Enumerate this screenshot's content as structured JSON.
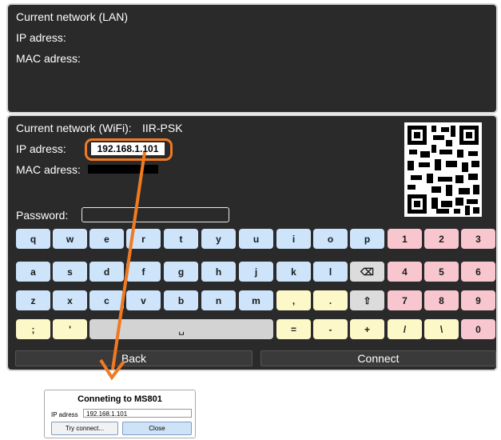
{
  "lan": {
    "title": "Current network (LAN)",
    "ip_label": "IP adress:",
    "mac_label": "MAC adress:"
  },
  "wifi": {
    "title_label": "Current network (WiFi):",
    "ssid": "IIR-PSK",
    "ip_label": "IP adress:",
    "ip_value": "192.168.1.101",
    "mac_label": "MAC adress:",
    "password_label": "Password:",
    "password_value": ""
  },
  "keyboard": {
    "rows": [
      [
        "q",
        "w",
        "e",
        "r",
        "t",
        "y",
        "u",
        "i",
        "o",
        "p",
        "1",
        "2",
        "3"
      ],
      [
        "a",
        "s",
        "d",
        "f",
        "g",
        "h",
        "j",
        "k",
        "l",
        "⌫",
        "4",
        "5",
        "6"
      ],
      [
        "z",
        "x",
        "c",
        "v",
        "b",
        "n",
        "m",
        ",",
        ".",
        "⇧",
        "7",
        "8",
        "9"
      ],
      [
        ";",
        "'",
        "␣",
        "=",
        "-",
        "+",
        "/",
        "\\",
        "0"
      ]
    ]
  },
  "actions": {
    "back": "Back",
    "connect": "Connect"
  },
  "dialog": {
    "title": "Conneting to MS801",
    "ip_label": "IP adress",
    "ip_value": "192.168.1.101",
    "try_button": "Try connect...",
    "close_button": "Close"
  },
  "colors": {
    "panel": "#2a2a2a",
    "annotation": "#f07a22",
    "key_letter": "#cde4fb",
    "key_symbol": "#fdf8c8",
    "key_number": "#f8c6cf"
  }
}
